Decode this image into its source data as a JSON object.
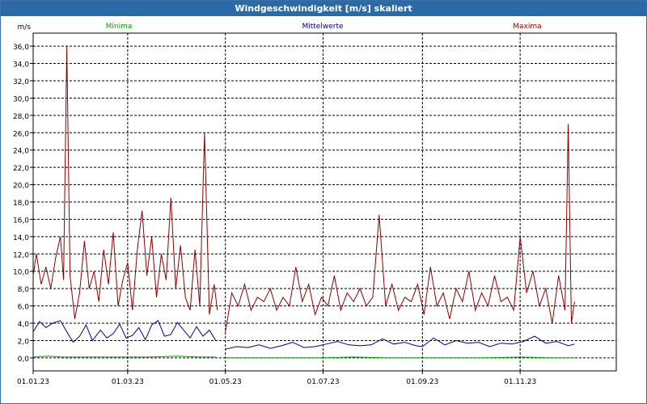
{
  "window": {
    "title": "Windgeschwindigkeit [m/s] skaliert"
  },
  "colors": {
    "minima": "#00a000",
    "mittelwerte": "#00008b",
    "maxima": "#8b0000",
    "titlebar": "#2b6aa6",
    "grid": "#000000"
  },
  "chart_data": {
    "type": "line",
    "title": "Windgeschwindigkeit [m/s] skaliert",
    "ylabel": "m/s",
    "xlabel": "",
    "ylim": [
      -1.5,
      37.5
    ],
    "xlim": [
      "2023-01-01",
      "2023-12-31"
    ],
    "y_ticks": [
      "0,0",
      "2,0",
      "4,0",
      "6,0",
      "8,0",
      "10,0",
      "12,0",
      "14,0",
      "16,0",
      "18,0",
      "20,0",
      "22,0",
      "24,0",
      "26,0",
      "28,0",
      "30,0",
      "32,0",
      "34,0",
      "36,0"
    ],
    "x_ticks": [
      "01.01.23",
      "01.03.23",
      "01.05.23",
      "01.07.23",
      "01.09.23",
      "01.11.23"
    ],
    "grid": true,
    "legend_position": "top",
    "series": [
      {
        "name": "Minima",
        "segments": [
          {
            "x": [
              "2023-01-01",
              "2023-01-10",
              "2023-01-20",
              "2023-01-30",
              "2023-02-10",
              "2023-02-20",
              "2023-03-01",
              "2023-03-15",
              "2023-04-01",
              "2023-04-15",
              "2023-04-25"
            ],
            "y": [
              0.1,
              0.2,
              0.1,
              0.1,
              0.1,
              0.1,
              0.1,
              0.1,
              0.2,
              0.1,
              0.1
            ]
          },
          {
            "x": [
              "2023-05-01",
              "2023-05-20",
              "2023-06-10",
              "2023-07-01",
              "2023-07-20",
              "2023-08-10",
              "2023-09-01",
              "2023-09-20",
              "2023-10-10",
              "2023-11-01",
              "2023-11-20",
              "2023-12-05"
            ],
            "y": [
              0.0,
              0.0,
              0.0,
              0.0,
              0.1,
              0.0,
              0.0,
              0.0,
              0.0,
              0.1,
              0.0,
              0.0
            ]
          }
        ]
      },
      {
        "name": "Mittelwerte",
        "segments": [
          {
            "x": [
              "2023-01-01",
              "2023-01-05",
              "2023-01-09",
              "2023-01-13",
              "2023-01-18",
              "2023-01-22",
              "2023-01-26",
              "2023-01-30",
              "2023-02-03",
              "2023-02-07",
              "2023-02-12",
              "2023-02-16",
              "2023-02-20",
              "2023-02-24",
              "2023-02-28",
              "2023-03-04",
              "2023-03-08",
              "2023-03-12",
              "2023-03-16",
              "2023-03-20",
              "2023-03-24",
              "2023-03-28",
              "2023-04-01",
              "2023-04-05",
              "2023-04-09",
              "2023-04-13",
              "2023-04-17",
              "2023-04-21",
              "2023-04-25"
            ],
            "y": [
              3.0,
              4.2,
              3.5,
              4.0,
              4.3,
              3.0,
              1.8,
              2.5,
              3.8,
              2.0,
              3.2,
              2.3,
              2.8,
              3.9,
              2.3,
              2.6,
              3.5,
              2.1,
              3.8,
              4.3,
              2.5,
              2.7,
              4.1,
              3.2,
              2.3,
              3.6,
              2.5,
              3.2,
              2.0
            ]
          },
          {
            "x": [
              "2023-05-01",
              "2023-05-08",
              "2023-05-15",
              "2023-05-22",
              "2023-05-29",
              "2023-06-05",
              "2023-06-12",
              "2023-06-19",
              "2023-06-26",
              "2023-07-03",
              "2023-07-10",
              "2023-07-17",
              "2023-07-24",
              "2023-07-31",
              "2023-08-07",
              "2023-08-14",
              "2023-08-21",
              "2023-08-28",
              "2023-09-01",
              "2023-09-08",
              "2023-09-15",
              "2023-09-22",
              "2023-09-29",
              "2023-10-06",
              "2023-10-13",
              "2023-10-20",
              "2023-10-27",
              "2023-11-03",
              "2023-11-10",
              "2023-11-17",
              "2023-11-24",
              "2023-12-01",
              "2023-12-05"
            ],
            "y": [
              1.0,
              1.3,
              1.2,
              1.5,
              1.1,
              1.4,
              1.8,
              1.2,
              1.3,
              1.6,
              1.9,
              1.5,
              1.4,
              1.5,
              2.2,
              1.6,
              1.8,
              1.4,
              1.3,
              2.3,
              1.5,
              2.0,
              1.7,
              1.8,
              1.3,
              1.7,
              1.6,
              1.9,
              2.5,
              1.7,
              1.9,
              1.4,
              1.6
            ]
          }
        ]
      },
      {
        "name": "Maxima",
        "segments": [
          {
            "x": [
              "2023-01-01",
              "2023-01-03",
              "2023-01-06",
              "2023-01-09",
              "2023-01-12",
              "2023-01-15",
              "2023-01-18",
              "2023-01-20",
              "2023-01-22",
              "2023-01-24",
              "2023-01-27",
              "2023-01-30",
              "2023-02-02",
              "2023-02-05",
              "2023-02-08",
              "2023-02-11",
              "2023-02-14",
              "2023-02-17",
              "2023-02-20",
              "2023-02-23",
              "2023-02-26",
              "2023-03-01",
              "2023-03-04",
              "2023-03-07",
              "2023-03-10",
              "2023-03-13",
              "2023-03-16",
              "2023-03-19",
              "2023-03-22",
              "2023-03-25",
              "2023-03-28",
              "2023-03-31",
              "2023-04-03",
              "2023-04-06",
              "2023-04-09",
              "2023-04-12",
              "2023-04-15",
              "2023-04-18",
              "2023-04-21",
              "2023-04-24",
              "2023-04-26"
            ],
            "y": [
              9.5,
              12.0,
              8.5,
              10.5,
              8.0,
              11.5,
              14.0,
              9.0,
              36.0,
              9.5,
              4.5,
              7.5,
              13.5,
              8.0,
              10.0,
              6.5,
              12.5,
              8.5,
              14.5,
              6.0,
              9.0,
              11.0,
              5.5,
              12.5,
              17.0,
              9.5,
              14.0,
              7.0,
              12.0,
              9.0,
              18.5,
              8.0,
              13.0,
              7.0,
              5.5,
              12.5,
              6.0,
              26.0,
              5.0,
              8.5,
              5.5
            ]
          },
          {
            "x": [
              "2023-05-01",
              "2023-05-05",
              "2023-05-09",
              "2023-05-13",
              "2023-05-17",
              "2023-05-21",
              "2023-05-25",
              "2023-05-29",
              "2023-06-02",
              "2023-06-06",
              "2023-06-10",
              "2023-06-14",
              "2023-06-18",
              "2023-06-22",
              "2023-06-26",
              "2023-06-30",
              "2023-07-04",
              "2023-07-08",
              "2023-07-12",
              "2023-07-16",
              "2023-07-20",
              "2023-07-24",
              "2023-07-28",
              "2023-08-01",
              "2023-08-05",
              "2023-08-09",
              "2023-08-13",
              "2023-08-17",
              "2023-08-21",
              "2023-08-25",
              "2023-08-29",
              "2023-09-02",
              "2023-09-06",
              "2023-09-10",
              "2023-09-14",
              "2023-09-18",
              "2023-09-22",
              "2023-09-26",
              "2023-09-30",
              "2023-10-04",
              "2023-10-08",
              "2023-10-12",
              "2023-10-16",
              "2023-10-20",
              "2023-10-24",
              "2023-10-28",
              "2023-11-01",
              "2023-11-05",
              "2023-11-09",
              "2023-11-13",
              "2023-11-17",
              "2023-11-21",
              "2023-11-25",
              "2023-11-29",
              "2023-12-01",
              "2023-12-03",
              "2023-12-05"
            ],
            "y": [
              3.0,
              7.5,
              6.0,
              8.5,
              5.5,
              7.0,
              6.5,
              8.0,
              5.5,
              7.0,
              6.0,
              10.5,
              6.5,
              8.5,
              5.0,
              7.0,
              6.0,
              9.5,
              5.5,
              7.5,
              6.5,
              8.0,
              6.0,
              7.0,
              16.5,
              6.0,
              8.5,
              5.5,
              7.0,
              6.5,
              8.5,
              5.0,
              10.5,
              6.0,
              7.5,
              4.5,
              8.0,
              6.5,
              10.0,
              5.5,
              7.5,
              6.0,
              9.5,
              6.5,
              7.0,
              5.5,
              14.0,
              7.5,
              10.0,
              6.0,
              8.0,
              4.0,
              9.5,
              5.5,
              27.0,
              4.0,
              6.5
            ]
          }
        ]
      }
    ]
  }
}
